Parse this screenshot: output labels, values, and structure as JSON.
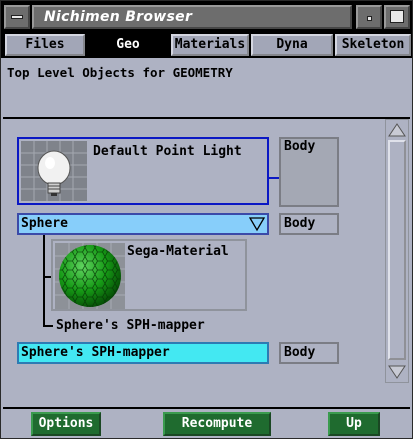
{
  "window": {
    "title": "Nichimen Browser"
  },
  "tabs": [
    {
      "label": "Files",
      "active": false
    },
    {
      "label": "Geo",
      "active": true
    },
    {
      "label": "Materials",
      "active": false
    },
    {
      "label": "Dyna",
      "active": false
    },
    {
      "label": "Skeleton",
      "active": false
    }
  ],
  "header": {
    "text": "Top Level Objects for GEOMETRY"
  },
  "objects": {
    "light": {
      "label": "Default Point Light",
      "body_label": "Body"
    },
    "sphere": {
      "label": "Sphere",
      "body_label": "Body"
    },
    "material": {
      "label": "Sega-Material"
    },
    "tree_child": {
      "label": "Sphere's SPH-mapper"
    },
    "mapper": {
      "label": "Sphere's SPH-mapper",
      "body_label": "Body"
    }
  },
  "buttons": {
    "options": "Options",
    "recompute": "Recompute",
    "up": "Up"
  },
  "icons": {
    "light_thumb": "lightbulb-icon",
    "material_thumb": "green-sphere-icon",
    "dropdown": "down-triangle-icon"
  },
  "colors": {
    "light_border": "#0b18c4",
    "sphere_bar": "#87cefa",
    "mapper_bar": "#43e8f2",
    "button_green": "#1f6b2f"
  }
}
